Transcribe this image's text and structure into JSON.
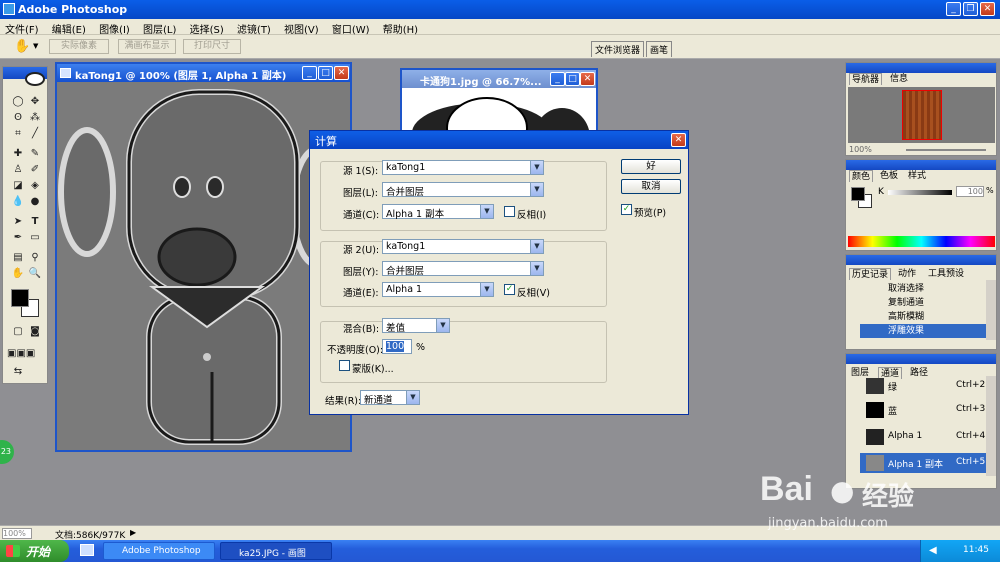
{
  "app": {
    "title": "Adobe Photoshop"
  },
  "menu": [
    "文件(F)",
    "编辑(E)",
    "图像(I)",
    "图层(L)",
    "选择(S)",
    "滤镜(T)",
    "视图(V)",
    "窗口(W)",
    "帮助(H)"
  ],
  "options": {
    "actual": "实际像素",
    "fit": "满画布显示",
    "print": "打印尺寸",
    "tab_files": "文件浏览器",
    "tab_brush": "画笔"
  },
  "doc1": {
    "title": "kaTong1 @ 100% (图层 1, Alpha 1 副本)"
  },
  "doc2": {
    "title": "卡通狗1.jpg @ 66.7%..."
  },
  "dialog": {
    "title": "计算",
    "src1": {
      "label": "源 1(S):",
      "value": "kaTong1",
      "layer_label": "图层(L):",
      "layer": "合并图层",
      "channel_label": "通道(C):",
      "channel": "Alpha 1 副本",
      "invert": "反相(I)"
    },
    "src2": {
      "label": "源 2(U):",
      "value": "kaTong1",
      "layer_label": "图层(Y):",
      "layer": "合并图层",
      "channel_label": "通道(E):",
      "channel": "Alpha 1",
      "invert": "反相(V)"
    },
    "blend_label": "混合(B):",
    "blend": "差值",
    "opacity_label": "不透明度(O):",
    "opacity": "100",
    "percent": "%",
    "mask": "蒙版(K)...",
    "result_label": "结果(R):",
    "result": "新通道",
    "ok": "好",
    "cancel": "取消",
    "preview": "预览(P)"
  },
  "nav": {
    "tab1": "导航器",
    "tab2": "信息",
    "zoom": "100%"
  },
  "color": {
    "tab1": "颜色",
    "tab2": "色板",
    "tab3": "样式",
    "k": "K",
    "value": "100",
    "percent": "%"
  },
  "history": {
    "tab1": "历史记录",
    "tab2": "动作",
    "tab3": "工具预设",
    "items": [
      "取消选择",
      "复制通道",
      "高斯模糊",
      "浮雕效果"
    ]
  },
  "channels": {
    "tab1": "图层",
    "tab2": "通道",
    "tab3": "路径",
    "rows": [
      {
        "name": "绿",
        "key": "Ctrl+2"
      },
      {
        "name": "蓝",
        "key": "Ctrl+3"
      },
      {
        "name": "Alpha 1",
        "key": "Ctrl+4"
      },
      {
        "name": "Alpha 1 副本",
        "key": "Ctrl+5"
      }
    ]
  },
  "status": {
    "zoom": "100%",
    "doc": "文档:586K/977K"
  },
  "taskbar": {
    "start": "开始",
    "task1": "Adobe Photoshop",
    "task2": "ka25.JPG - 画图",
    "time": "11:45"
  },
  "badge": "23",
  "watermark": {
    "brand": "Bai",
    "brand2": "经验",
    "url": "jingyan.baidu.com"
  }
}
